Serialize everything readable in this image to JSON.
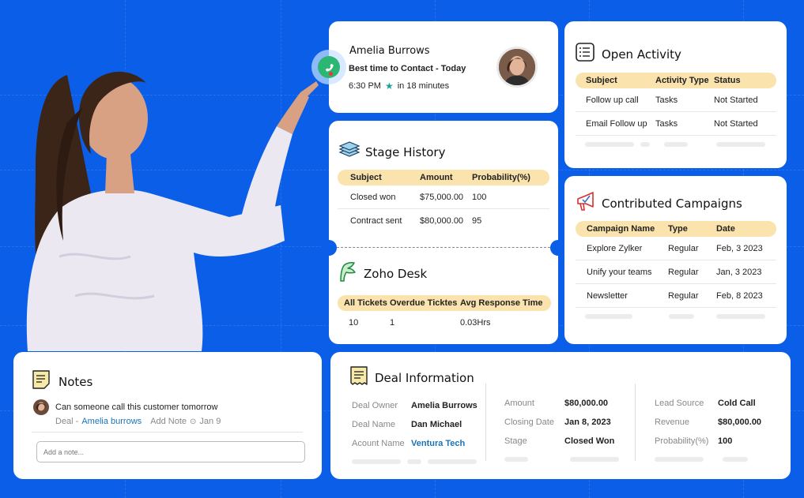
{
  "contact": {
    "name": "Amelia Burrows",
    "best_time_label": "Best time to Contact - Today",
    "time": "6:30 PM",
    "eta": "in 18 minutes"
  },
  "open_activity": {
    "title": "Open Activity",
    "columns": [
      "Subject",
      "Activity Type",
      "Status"
    ],
    "rows": [
      [
        "Follow up call",
        "Tasks",
        "Not Started"
      ],
      [
        "Email Follow up",
        "Tasks",
        "Not Started"
      ]
    ]
  },
  "stage_history": {
    "title": "Stage History",
    "columns": [
      "Subject",
      "Amount",
      "Probability(%)"
    ],
    "rows": [
      [
        "Closed won",
        "$75,000.00",
        "100"
      ],
      [
        "Contract sent",
        "$80,000.00",
        "95"
      ]
    ]
  },
  "zoho_desk": {
    "title": "Zoho Desk",
    "columns": [
      "All Tickets",
      "Overdue Ticktes",
      "Avg Response Time"
    ],
    "rows": [
      [
        "10",
        "1",
        "0.03Hrs"
      ]
    ]
  },
  "campaigns": {
    "title": "Contributed Campaigns",
    "columns": [
      "Campaign Name",
      "Type",
      "Date"
    ],
    "rows": [
      [
        "Explore Zylker",
        "Regular",
        "Feb, 3 2023"
      ],
      [
        "Unify your teams",
        "Regular",
        "Jan, 3 2023"
      ],
      [
        "Newsletter",
        "Regular",
        "Feb, 8 2023"
      ]
    ]
  },
  "notes": {
    "title": "Notes",
    "note_text": "Can someone call this customer tomorrow",
    "deal_prefix": "Deal -",
    "deal_link": "Amelia burrows",
    "add_note": "Add Note",
    "date": "Jan 9",
    "placeholder": "Add a note..."
  },
  "deal_info": {
    "title": "Deal Information",
    "col1": [
      {
        "label": "Deal Owner",
        "value": "Amelia Burrows"
      },
      {
        "label": "Deal Name",
        "value": "Dan Michael"
      },
      {
        "label": "Acount Name",
        "value": "Ventura Tech"
      }
    ],
    "col2": [
      {
        "label": "Amount",
        "value": "$80,000.00"
      },
      {
        "label": "Closing Date",
        "value": "Jan 8, 2023"
      },
      {
        "label": "Stage",
        "value": "Closed Won"
      }
    ],
    "col3": [
      {
        "label": "Lead Source",
        "value": "Cold Call"
      },
      {
        "label": "Revenue",
        "value": "$80,000.00"
      },
      {
        "label": "Probability(%)",
        "value": "100"
      }
    ]
  },
  "colors": {
    "background": "#0b5ee8",
    "header_row": "#fbe3ad",
    "link": "#1a73b8",
    "call_green": "#2bb673"
  }
}
